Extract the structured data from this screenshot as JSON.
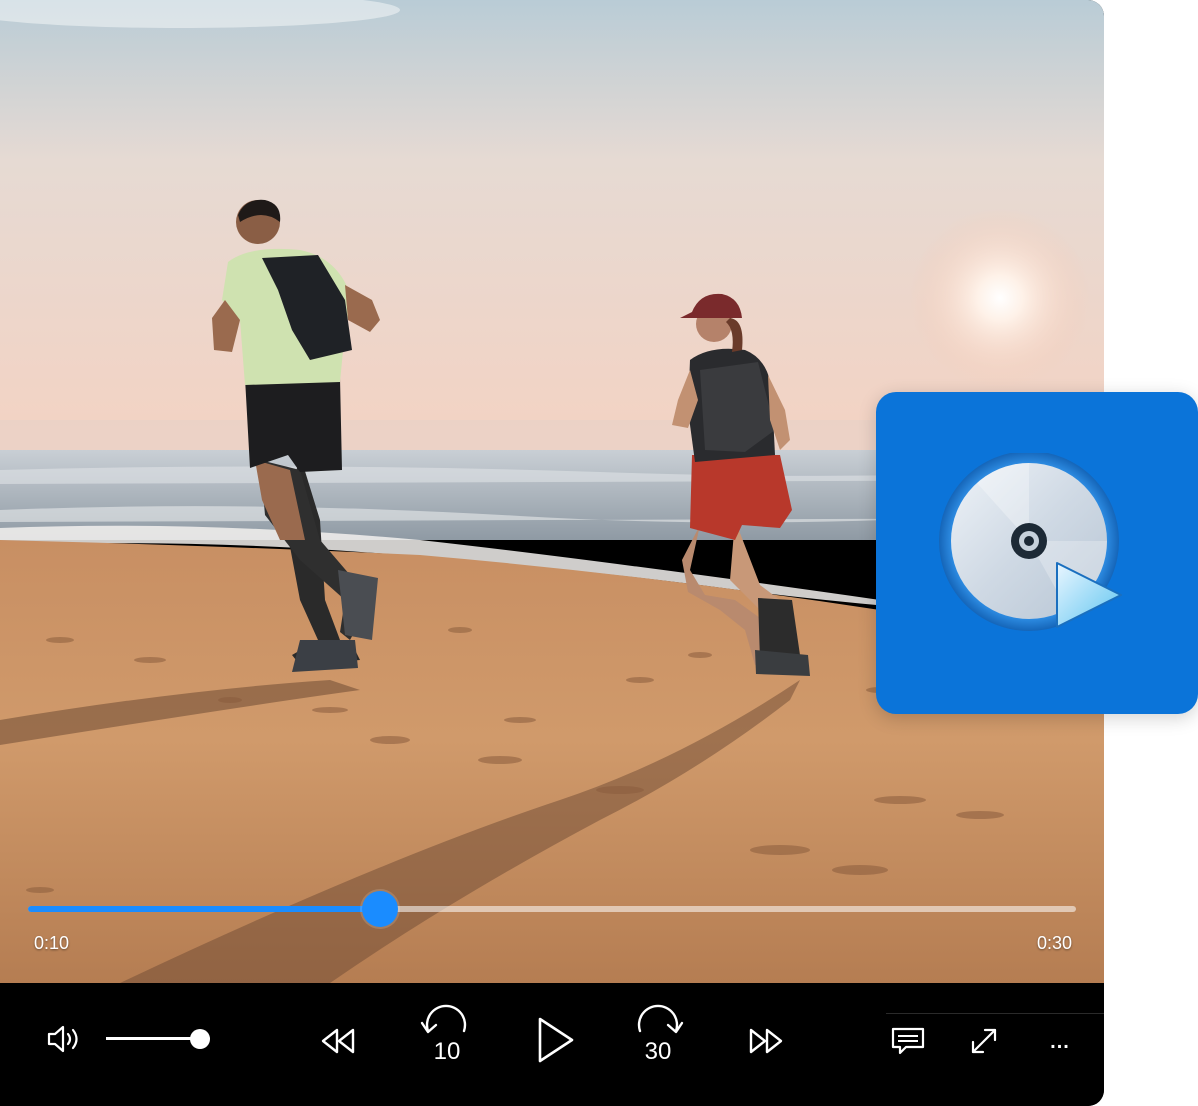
{
  "player": {
    "current_time": "0:10",
    "total_time": "0:30",
    "progress": 0.336,
    "volume": 0.9,
    "skip_back_seconds": "10",
    "skip_forward_seconds": "30",
    "more_label": "...",
    "accent_color": "#1a8cff"
  },
  "icons": {
    "volume": "volume-icon",
    "rewind": "rewind-icon",
    "skip_back": "skip-back-10-icon",
    "play": "play-icon",
    "skip_forward": "skip-forward-30-icon",
    "fast_forward": "fast-forward-icon",
    "captions": "captions-icon",
    "fullscreen": "fullscreen-icon",
    "more": "more-icon",
    "app": "media-player-app-icon"
  },
  "app_icon": {
    "background_color": "#0b74d9"
  }
}
